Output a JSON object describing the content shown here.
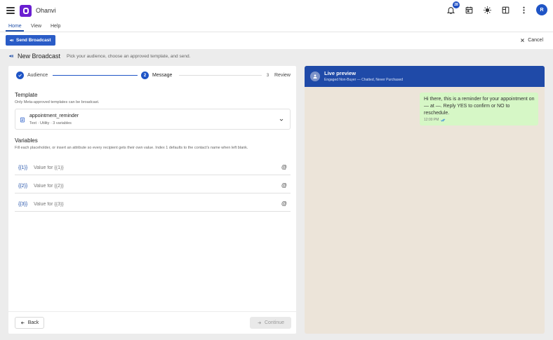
{
  "app": {
    "title": "Ohanvi",
    "notification_count": "28",
    "avatar_initial": "R"
  },
  "menu": {
    "tabs": [
      "Home",
      "View",
      "Help"
    ]
  },
  "ribbon": {
    "send_broadcast_label": "Send Broadcast",
    "cancel_label": "Cancel"
  },
  "page": {
    "title": "New Broadcast",
    "subtitle": "Pick your audience, choose an approved template, and send."
  },
  "stepper": {
    "steps": [
      {
        "number": "1",
        "label": "Audience",
        "state": "done"
      },
      {
        "number": "2",
        "label": "Message",
        "state": "current"
      },
      {
        "number": "3",
        "label": "Review",
        "state": "idle"
      }
    ]
  },
  "template": {
    "section_title": "Template",
    "hint": "Only Meta-approved templates can be broadcast.",
    "selected_name": "appointment_reminder",
    "selected_meta": "Text · Utility · 3 variables"
  },
  "variables": {
    "section_title": "Variables",
    "hint": "Fill each placeholder, or insert an attribute so every recipient gets their own value. Index 1 defaults to the contact's name when left blank.",
    "items": [
      {
        "key": "{{1}}",
        "placeholder": "Value for {{1}}",
        "value": ""
      },
      {
        "key": "{{2}}",
        "placeholder": "Value for {{2}}",
        "value": ""
      },
      {
        "key": "{{3}}",
        "placeholder": "Value for {{3}}",
        "value": ""
      }
    ],
    "insert_symbol": "@"
  },
  "footer": {
    "back_label": "Back",
    "continue_label": "Continue"
  },
  "preview": {
    "title": "Live preview",
    "audience": "Engaged Non-Buyer — Chatted, Never Purchased",
    "message": "Hi there, this is a reminder for your appointment on — at —. Reply YES to confirm or NO to reschedule.",
    "time": "12:00 PM"
  },
  "colors": {
    "brand": "#6a1fd1",
    "primary": "#1f55c6",
    "header_blue": "#1f4aa8",
    "bubble": "#d6f7c6",
    "chat_bg": "#ece4d9"
  }
}
